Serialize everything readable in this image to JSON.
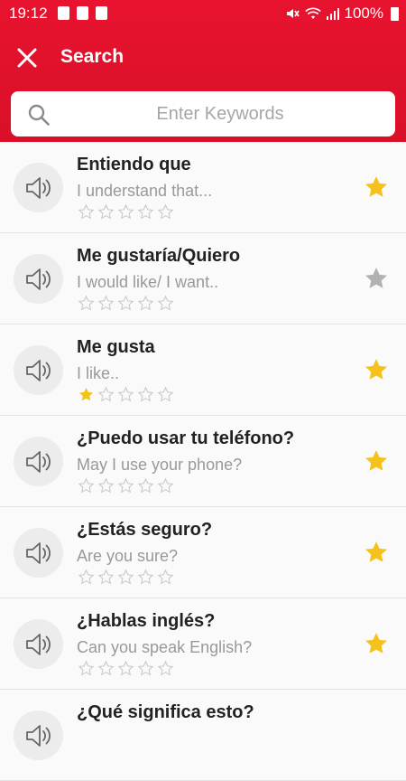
{
  "status": {
    "time": "19:12",
    "battery": "100%"
  },
  "toolbar": {
    "title": "Search"
  },
  "search": {
    "placeholder": "Enter Keywords",
    "value": ""
  },
  "colors": {
    "brand": "#e8132f",
    "star_active": "#f4c21b",
    "star_inactive": "#b2b2b2"
  },
  "items": [
    {
      "phrase": "Entiendo que",
      "translation": "I understand that...",
      "rating": 0,
      "favorite": true
    },
    {
      "phrase": "Me gustaría/Quiero",
      "translation": "I would like/ I want..",
      "rating": 0,
      "favorite": false
    },
    {
      "phrase": "Me gusta",
      "translation": "I like..",
      "rating": 1,
      "favorite": true
    },
    {
      "phrase": "¿Puedo usar tu teléfono?",
      "translation": "May I use your phone?",
      "rating": 0,
      "favorite": true
    },
    {
      "phrase": "¿Estás seguro?",
      "translation": "Are you sure?",
      "rating": 0,
      "favorite": true
    },
    {
      "phrase": "¿Hablas inglés?",
      "translation": "Can you speak English?",
      "rating": 0,
      "favorite": true
    },
    {
      "phrase": "¿Qué significa esto?",
      "translation": "",
      "rating": 0,
      "favorite": false
    }
  ]
}
